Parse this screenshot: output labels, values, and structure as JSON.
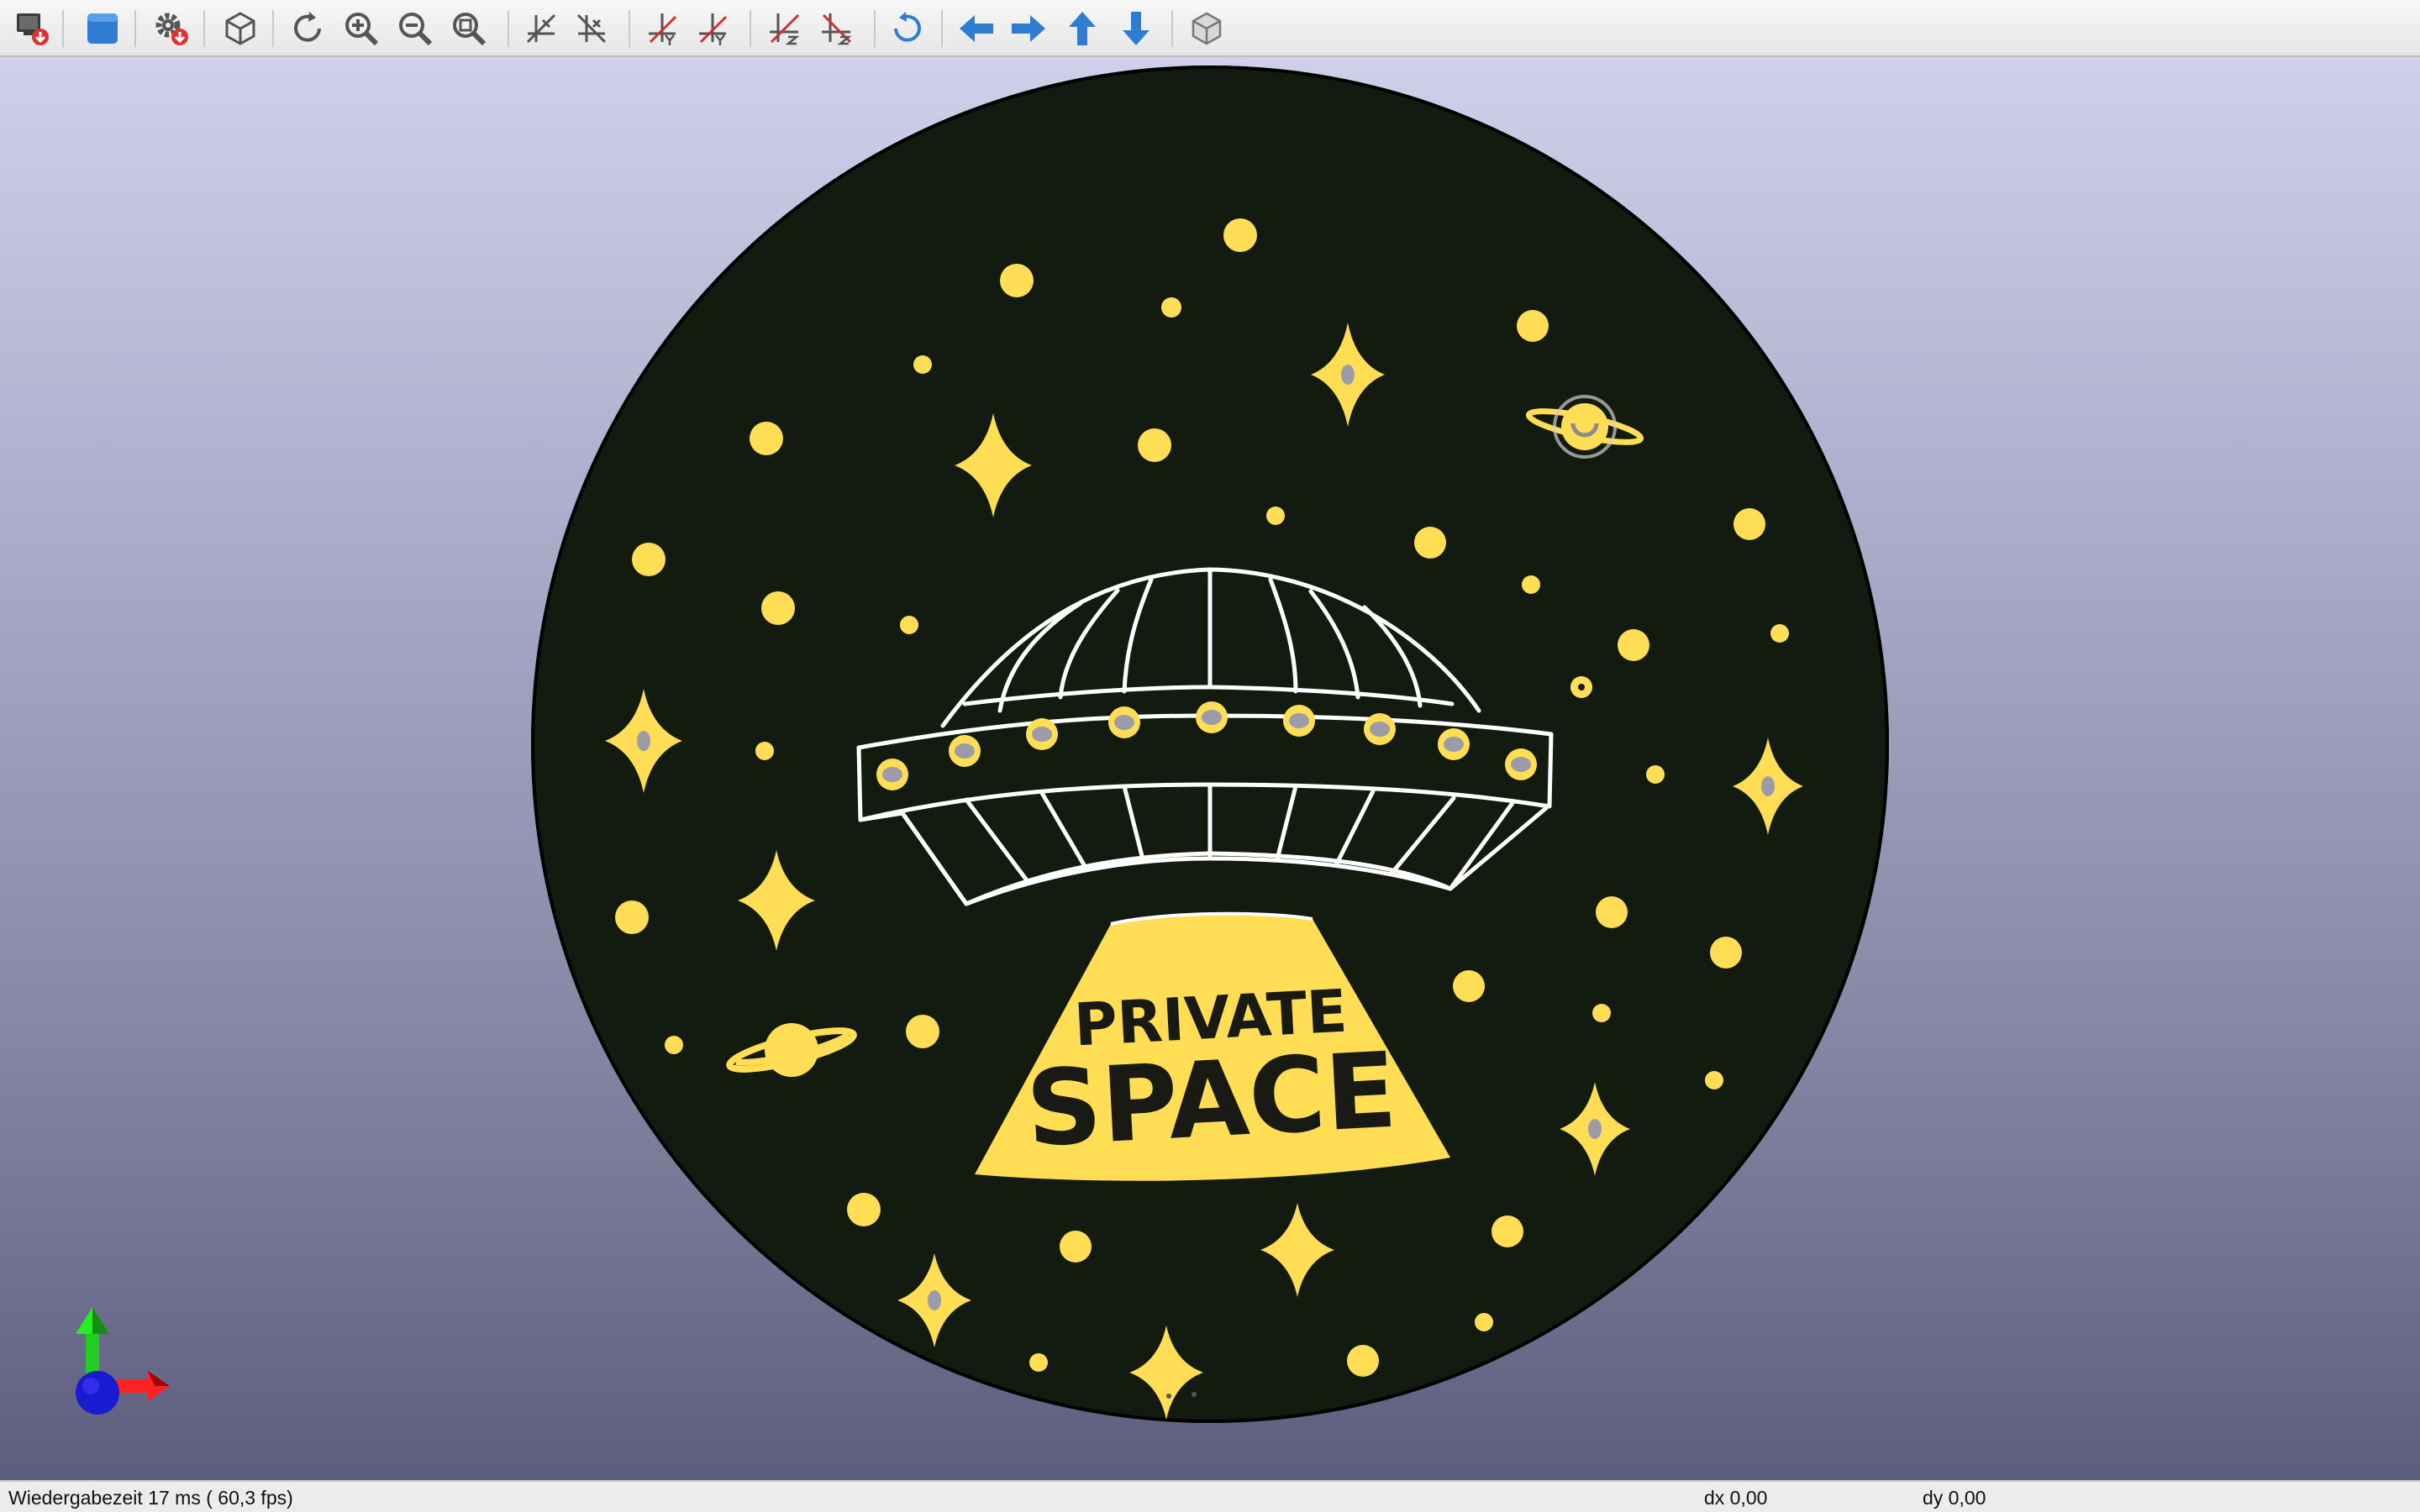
{
  "toolbar": {
    "buttons": [
      {
        "id": "export",
        "icon": "monitor-export-icon"
      },
      {
        "id": "view-style",
        "icon": "solid-cube-icon"
      },
      {
        "id": "settings",
        "icon": "gear-icon"
      },
      {
        "id": "reset-view",
        "icon": "iso-cube-icon"
      },
      {
        "id": "rotate",
        "icon": "rotate-icon"
      },
      {
        "id": "zoom-in",
        "icon": "zoom-in-icon"
      },
      {
        "id": "zoom-out",
        "icon": "zoom-out-icon"
      },
      {
        "id": "zoom-fit",
        "icon": "zoom-fit-icon"
      },
      {
        "id": "flip-x-1",
        "icon": "axis-x-flip-icon"
      },
      {
        "id": "flip-x-2",
        "icon": "axis-x-flip-icon"
      },
      {
        "id": "flip-y-1",
        "icon": "axis-y-flip-icon"
      },
      {
        "id": "flip-y-2",
        "icon": "axis-y-flip-icon"
      },
      {
        "id": "flip-z-1",
        "icon": "axis-z-flip-icon"
      },
      {
        "id": "flip-z-2",
        "icon": "axis-z-flip-icon"
      },
      {
        "id": "redo-rotate",
        "icon": "clockwise-arrow-icon"
      },
      {
        "id": "arrow-left",
        "icon": "arrow-left-icon"
      },
      {
        "id": "arrow-right",
        "icon": "arrow-right-icon"
      },
      {
        "id": "arrow-up",
        "icon": "arrow-up-icon"
      },
      {
        "id": "arrow-down",
        "icon": "arrow-down-icon"
      },
      {
        "id": "wire-cube",
        "icon": "wire-cube-icon"
      }
    ]
  },
  "scene": {
    "badge_line1": "PRIVATE",
    "badge_line2": "SPACE",
    "colors": {
      "disc": "#131a0f",
      "accent": "#ffdd55",
      "outline": "#ffffff",
      "hole": "#9c9ca8"
    }
  },
  "status": {
    "render_time": "Wiedergabezeit 17 ms ( 60,3 fps)",
    "dx": "dx 0,00",
    "dy": "dy 0,00"
  }
}
